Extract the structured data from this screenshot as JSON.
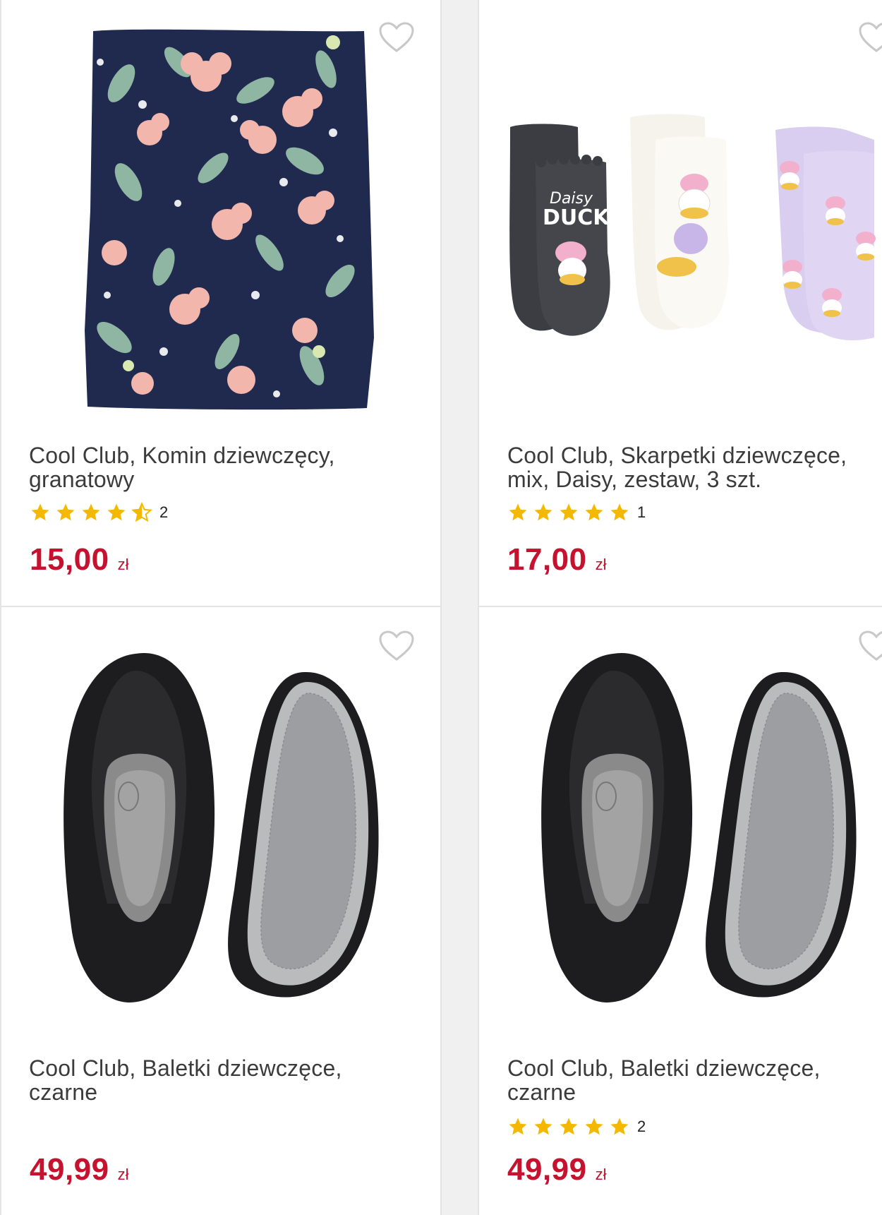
{
  "products": [
    {
      "title": "Cool Club, Komin dziewczęcy, granatowy",
      "rating_count": "2",
      "rating": 4.5,
      "price": "15,00",
      "currency": "zł",
      "image": "floral-neck-warmer"
    },
    {
      "title": "Cool Club, Skarpetki dziewczęce, mix, Daisy, zestaw, 3 szt.",
      "rating_count": "1",
      "rating": 5,
      "price": "17,00",
      "currency": "zł",
      "image": "daisy-duck-socks",
      "sock_text": "Daisy DUCK"
    },
    {
      "title": "Cool Club, Baletki dziewczęce, czarne",
      "rating_count": "",
      "rating": 0,
      "price": "49,99",
      "currency": "zł",
      "image": "black-ballet-slippers"
    },
    {
      "title": "Cool Club, Baletki dziewczęce, czarne",
      "rating_count": "2",
      "rating": 5,
      "price": "49,99",
      "currency": "zł",
      "image": "black-ballet-slippers"
    }
  ],
  "colors": {
    "price": "#c4122f",
    "star": "#f5b800",
    "title": "#3b3b3b",
    "card_border": "#e4e4e4"
  },
  "icons": {
    "favorite": "heart-outline-icon",
    "star": "star-icon",
    "half_star": "star-half-icon"
  }
}
